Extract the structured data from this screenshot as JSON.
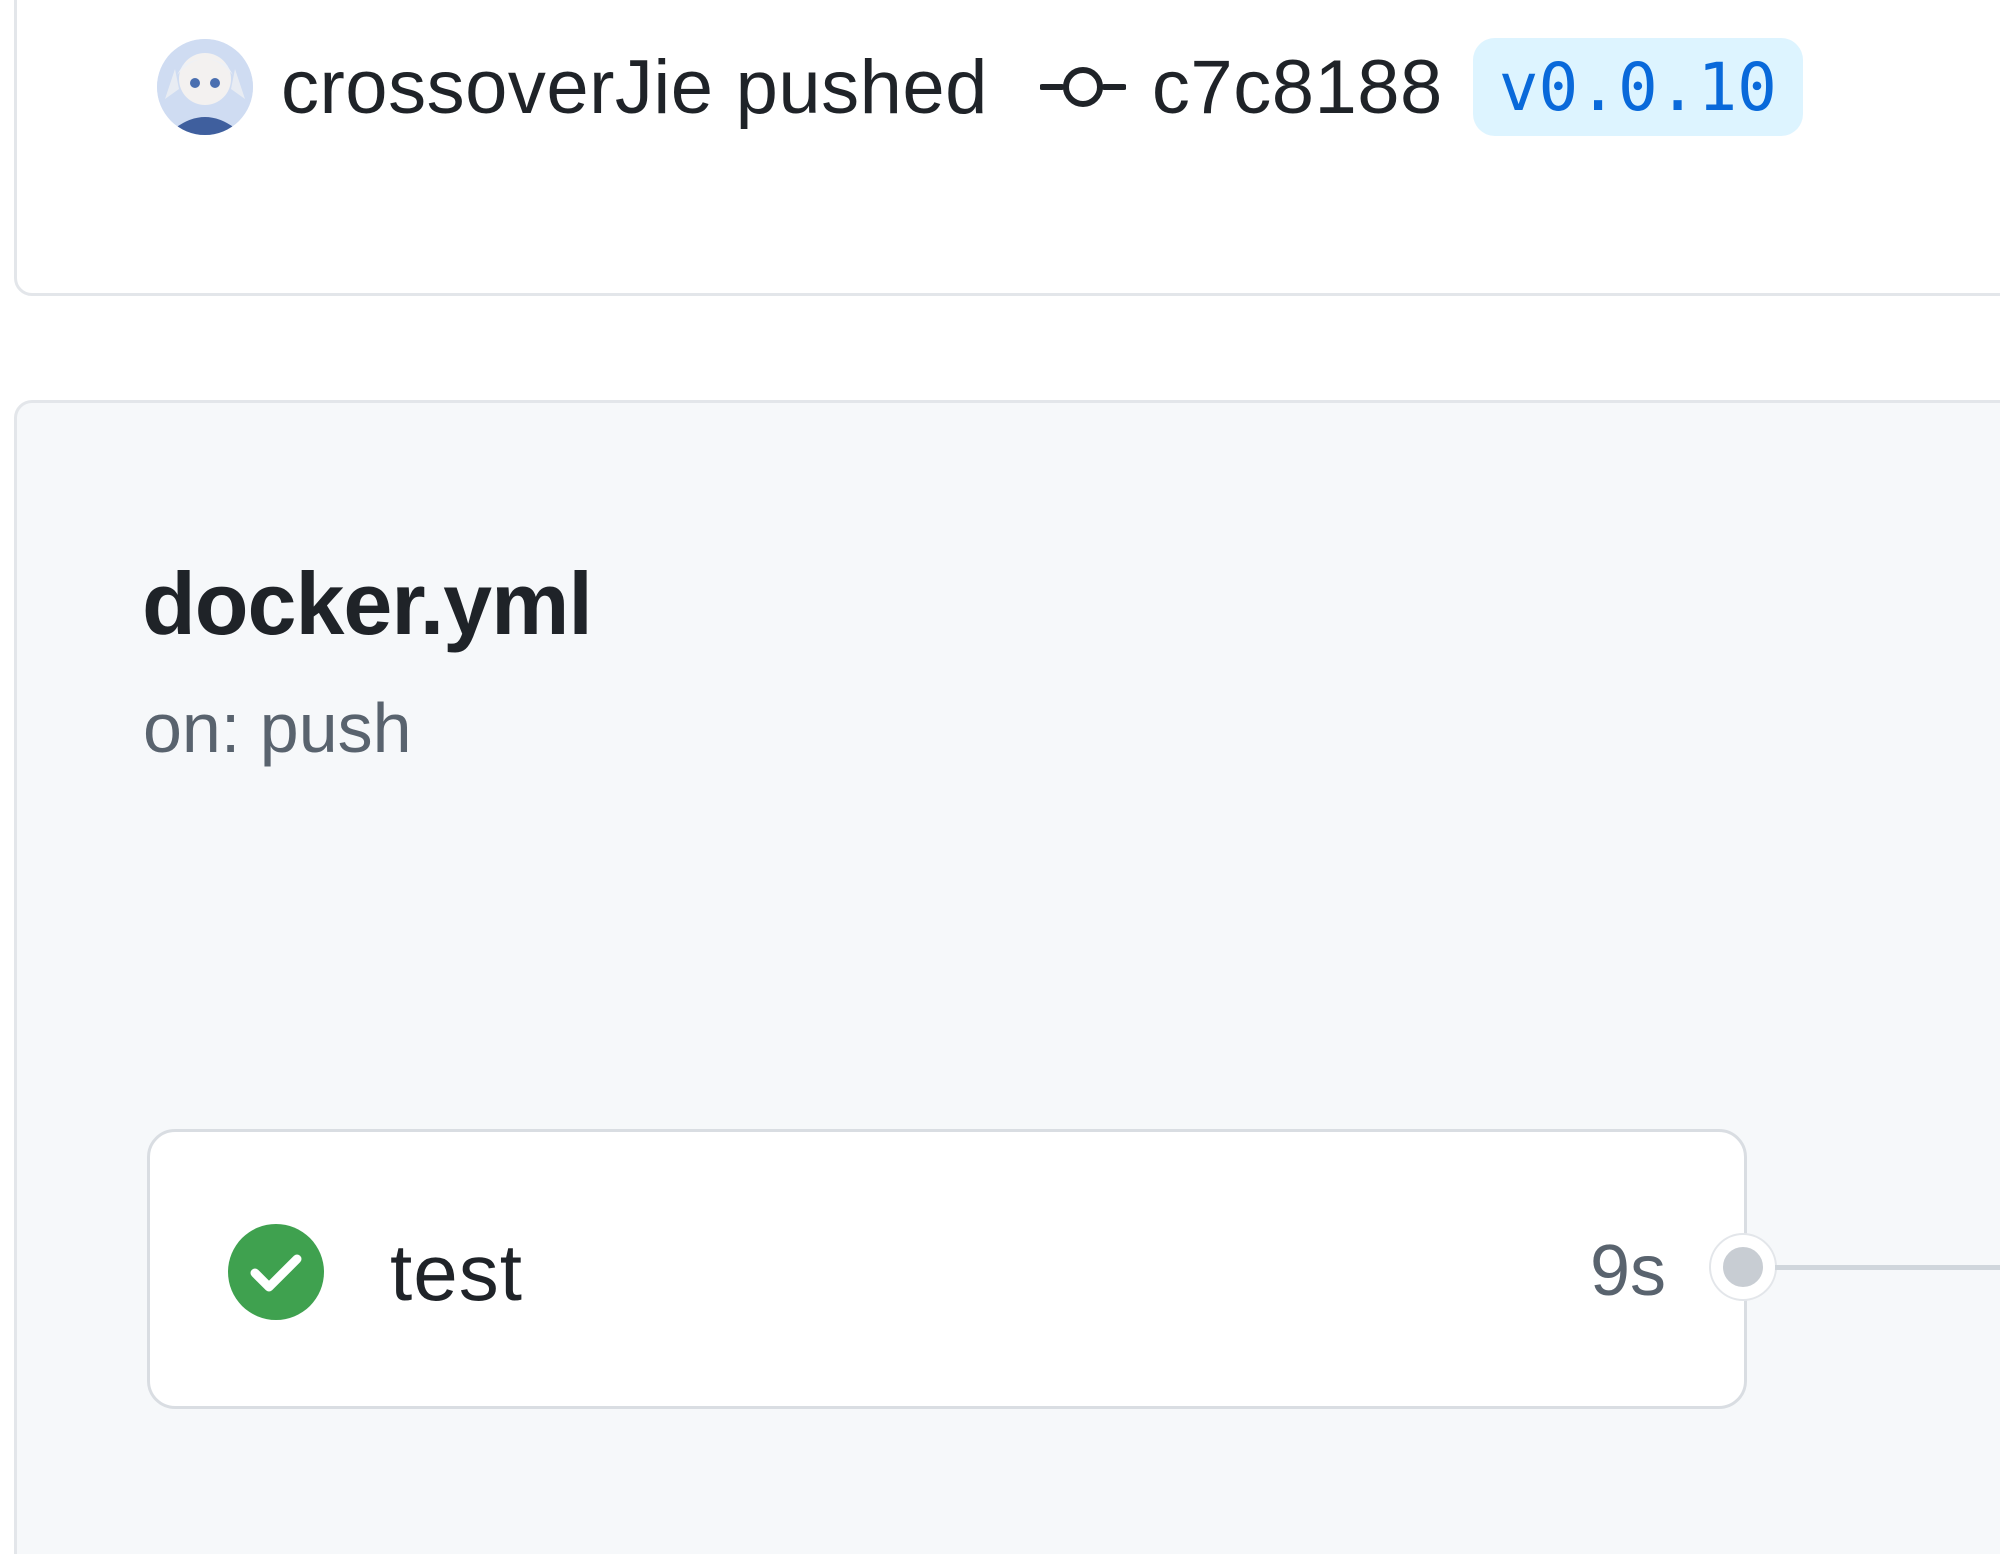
{
  "header": {
    "actor": "crossoverJie",
    "action": "pushed",
    "commit_sha": "c7c8188",
    "tag": "v0.0.10"
  },
  "workflow": {
    "file": "docker.yml",
    "trigger": "on: push",
    "jobs": [
      {
        "name": "test",
        "status": "success",
        "duration": "9s"
      }
    ]
  },
  "colors": {
    "success": "#1a7f37",
    "tag_bg": "#ddf4ff",
    "tag_text": "#0969da"
  }
}
